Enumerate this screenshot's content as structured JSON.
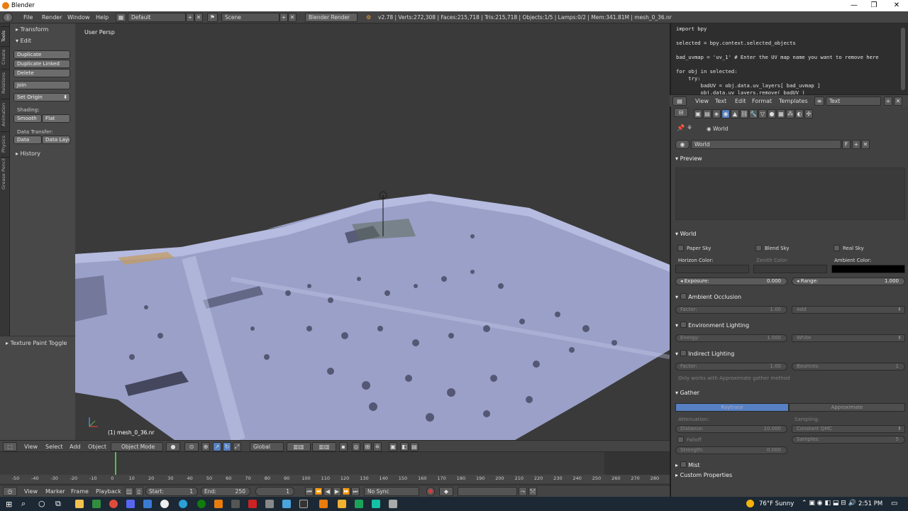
{
  "window": {
    "title": "Blender",
    "minimize": "—",
    "maximize": "❐",
    "close": "✕"
  },
  "info_header": {
    "menus": [
      "File",
      "Render",
      "Window",
      "Help"
    ],
    "layout": "Default",
    "scene": "Scene",
    "engine": "Blender Render",
    "stats": "v2.78 | Verts:272,308 | Faces:215,718 | Tris:215,718 | Objects:1/5 | Lamps:0/2 | Mem:341.81M | mesh_0_36.nr"
  },
  "left_tabs": [
    "Tools",
    "Create",
    "Relations",
    "Animation",
    "Physics",
    "Grease Pencil"
  ],
  "tool_shelf": {
    "transform": "Transform",
    "edit": "Edit",
    "buttons": [
      "Duplicate",
      "Duplicate Linked",
      "Delete"
    ],
    "join": "Join",
    "set_origin": "Set Origin",
    "shading_label": "Shading:",
    "smooth": "Smooth",
    "flat": "Flat",
    "data_transfer_label": "Data Transfer:",
    "data": "Data",
    "data_layout": "Data Layo",
    "history": "History"
  },
  "texture_paint_toggle": "Texture Paint Toggle",
  "viewport": {
    "view_name": "User Persp",
    "object_label": "(1) mesh_0_36.nr"
  },
  "view3d_header": {
    "menus": [
      "View",
      "Select",
      "Add",
      "Object"
    ],
    "mode": "Object Mode",
    "orientation": "Global"
  },
  "timeline": {
    "ticks": [
      "-50",
      "-40",
      "-30",
      "-20",
      "-10",
      "0",
      "10",
      "20",
      "30",
      "40",
      "50",
      "60",
      "70",
      "80",
      "90",
      "100",
      "110",
      "120",
      "130",
      "140",
      "150",
      "160",
      "170",
      "180",
      "190",
      "200",
      "210",
      "220",
      "230",
      "240",
      "250",
      "260",
      "270",
      "280"
    ],
    "menus": [
      "View",
      "Marker",
      "Frame",
      "Playback"
    ],
    "start_label": "Start:",
    "start": "1",
    "end_label": "End:",
    "end": "250",
    "current": "1",
    "sync": "No Sync"
  },
  "text_editor": {
    "lines": [
      "import bpy",
      "",
      "selected = bpy.context.selected_objects",
      "",
      "bad_uvmap = 'uv_1' # Enter the UV map name you want to remove here",
      "",
      "for obj in selected:",
      "    try:",
      "        badUV = obj.data.uv_layers[ bad_uvmap ]",
      "        obj.data.uv_layers.remove( badUV )"
    ],
    "menus": [
      "View",
      "Text",
      "Edit",
      "Format",
      "Templates"
    ],
    "datablock": "Text"
  },
  "properties": {
    "breadcrumb": "World",
    "world_field": "World",
    "world_f": "F",
    "preview": "Preview",
    "world_section": "World",
    "paper_sky": "Paper Sky",
    "blend_sky": "Blend Sky",
    "real_sky": "Real Sky",
    "horizon_color": "Horizon Color:",
    "zenith_color": "Zenith Color:",
    "ambient_color": "Ambient Color:",
    "exposure_label": "Exposure:",
    "exposure": "0.000",
    "range_label": "Range:",
    "range": "1.000",
    "ao": "Ambient Occlusion",
    "ao_factor_label": "Factor:",
    "ao_factor": "1.00",
    "ao_blend": "Add",
    "env": "Environment Lighting",
    "env_energy_label": "Energy:",
    "env_energy": "1.000",
    "env_color": "White",
    "indirect": "Indirect Lighting",
    "ind_factor_label": "Factor:",
    "ind_factor": "1.00",
    "bounces_label": "Bounces:",
    "bounces": "1",
    "indirect_note": "Only works with Approximate gather method",
    "gather": "Gather",
    "raytrace": "Raytrace",
    "approximate": "Approximate",
    "attenuation": "Attenuation:",
    "sampling": "Sampling:",
    "distance_label": "Distance:",
    "distance": "10.000",
    "sampling_method": "Constant QMC",
    "falloff": "Falloff",
    "samples_label": "Samples:",
    "samples": "5",
    "strength_label": "Strength:",
    "strength": "0.000",
    "mist": "Mist",
    "custom_props": "Custom Properties"
  },
  "taskbar": {
    "weather": "76°F  Sunny",
    "time": "2:51 PM"
  }
}
